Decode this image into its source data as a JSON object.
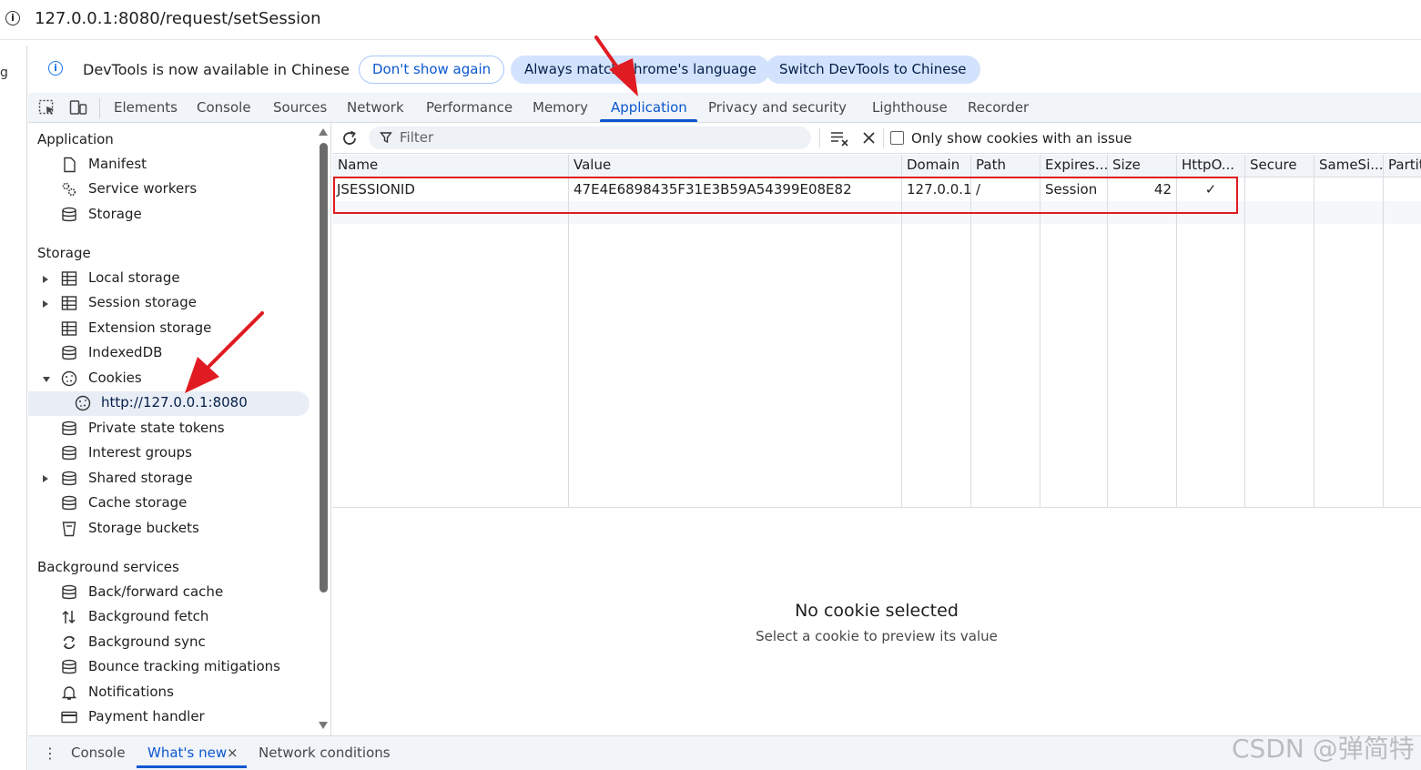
{
  "address_bar": {
    "url": "127.0.0.1:8080/request/setSession"
  },
  "infobar": {
    "message": "DevTools is now available in Chinese",
    "dont_show": "Don't show again",
    "always_match": "Always match Chrome's language",
    "switch_chinese": "Switch DevTools to Chinese"
  },
  "tabs": [
    "Elements",
    "Console",
    "Sources",
    "Network",
    "Performance",
    "Memory",
    "Application",
    "Privacy and security",
    "Lighthouse",
    "Recorder"
  ],
  "active_tab": "Application",
  "sidebar": {
    "application_header": "Application",
    "application_items": [
      "Manifest",
      "Service workers",
      "Storage"
    ],
    "storage_header": "Storage",
    "storage_items": [
      "Local storage",
      "Session storage",
      "Extension storage",
      "IndexedDB",
      "Cookies",
      "http://127.0.0.1:8080",
      "Private state tokens",
      "Interest groups",
      "Shared storage",
      "Cache storage",
      "Storage buckets"
    ],
    "background_header": "Background services",
    "background_items": [
      "Back/forward cache",
      "Background fetch",
      "Background sync",
      "Bounce tracking mitigations",
      "Notifications",
      "Payment handler"
    ]
  },
  "cookie_toolbar": {
    "filter_placeholder": "Filter",
    "only_issue_label": "Only show cookies with an issue"
  },
  "cookie_table": {
    "columns": [
      "Name",
      "Value",
      "Domain",
      "Path",
      "Expires...",
      "Size",
      "HttpO...",
      "Secure",
      "SameSi...",
      "Partit"
    ],
    "rows": [
      {
        "name": "JSESSIONID",
        "value": "47E4E6898435F31E3B59A54399E08E82",
        "domain": "127.0.0.1",
        "path": "/",
        "expires": "Session",
        "size": "42",
        "httponly": "✓",
        "secure": "",
        "samesite": "",
        "partition": ""
      }
    ]
  },
  "preview": {
    "title": "No cookie selected",
    "subtitle": "Select a cookie to preview its value"
  },
  "drawer": {
    "tabs": [
      "Console",
      "What's new",
      "Network conditions"
    ],
    "active": "What's new",
    "close_glyph": "×"
  },
  "watermark": "CSDN @弹简特",
  "colors": {
    "accent": "#0b57d0",
    "annotation_red": "#e01c22",
    "tab_bar_bg": "#f1f4f9",
    "selected_bg": "#e9eef6"
  },
  "icons": {
    "reload": "reload-icon",
    "filter": "filter-icon",
    "clear_all": "clear-all-icon",
    "delete": "close-icon",
    "inspect": "inspect-element-icon",
    "device": "device-toolbar-icon"
  }
}
